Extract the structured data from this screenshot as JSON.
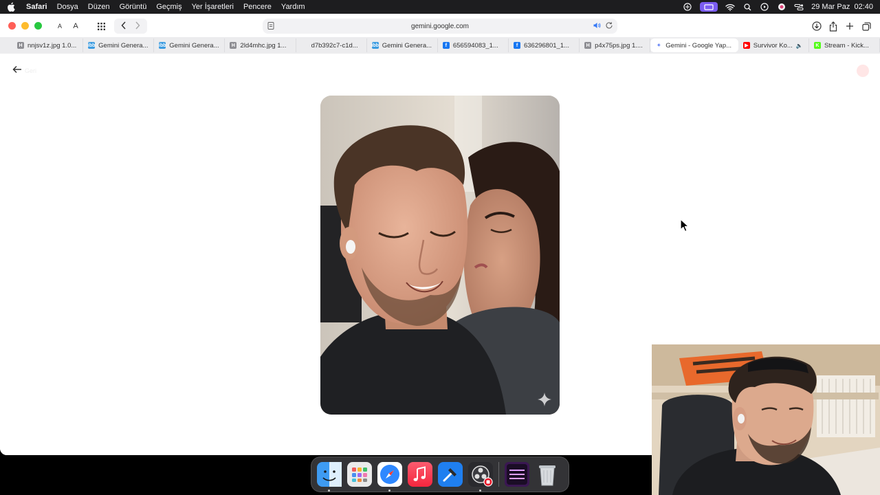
{
  "menubar": {
    "apple_icon": "apple-logo-icon",
    "items": [
      "Safari",
      "Dosya",
      "Düzen",
      "Görüntü",
      "Geçmiş",
      "Yer İşaretleri",
      "Pencere",
      "Yardım"
    ],
    "status_icons": [
      "sync-icon",
      "screen-mirroring-icon",
      "wifi-icon",
      "search-icon",
      "media-play-icon",
      "focus-icon",
      "control-center-icon"
    ],
    "datetime": "29 Mar Paz  02:40"
  },
  "toolbar": {
    "font_small": "A",
    "font_large": "A",
    "url": "gemini.google.com"
  },
  "tabs": [
    {
      "title": "nnjsv1z.jpg 1.0...",
      "favicon": "H",
      "color": "#8e8e93"
    },
    {
      "title": "Gemini Genera...",
      "favicon": "ibb",
      "color": "#3b9be0"
    },
    {
      "title": "Gemini Genera...",
      "favicon": "ibb",
      "color": "#3b9be0"
    },
    {
      "title": "2ld4mhc.jpg 1...",
      "favicon": "H",
      "color": "#8e8e93"
    },
    {
      "title": "d7b392c7-c1d...",
      "favicon": "",
      "color": "#ececee"
    },
    {
      "title": "Gemini Genera...",
      "favicon": "ibb",
      "color": "#3b9be0"
    },
    {
      "title": "656594083_1...",
      "favicon": "f",
      "color": "#1877f2"
    },
    {
      "title": "636296801_1...",
      "favicon": "f",
      "color": "#1877f2"
    },
    {
      "title": "p4x75ps.jpg 1....",
      "favicon": "H",
      "color": "#8e8e93"
    },
    {
      "title": "Gemini - Google Yap...",
      "favicon": "✦",
      "color": "#5b7cf5",
      "active": true
    },
    {
      "title": "Survivor Ko...",
      "favicon": "▶",
      "color": "#ff0000",
      "audio": true
    },
    {
      "title": "Stream - Kick...",
      "favicon": "K",
      "color": "#53fc18"
    }
  ],
  "content": {
    "back_label": "Geri",
    "caption": "",
    "image_alt": "Generated photo of a couple"
  },
  "dock": {
    "apps": [
      {
        "name": "finder",
        "color": "#3e9bf2",
        "running": true
      },
      {
        "name": "launchpad",
        "color": "#eaeaea",
        "running": false
      },
      {
        "name": "safari",
        "color": "#2f88ff",
        "running": true
      },
      {
        "name": "music",
        "color": "#fa3c50",
        "running": false
      },
      {
        "name": "xcode",
        "color": "#1f7ff0",
        "running": false
      },
      {
        "name": "obs",
        "color": "#2a2a2e",
        "running": true
      },
      {
        "name": "stream-app",
        "color": "#3a1752",
        "running": false
      },
      {
        "name": "trash",
        "color": "#c8ccd2",
        "running": false
      }
    ]
  }
}
